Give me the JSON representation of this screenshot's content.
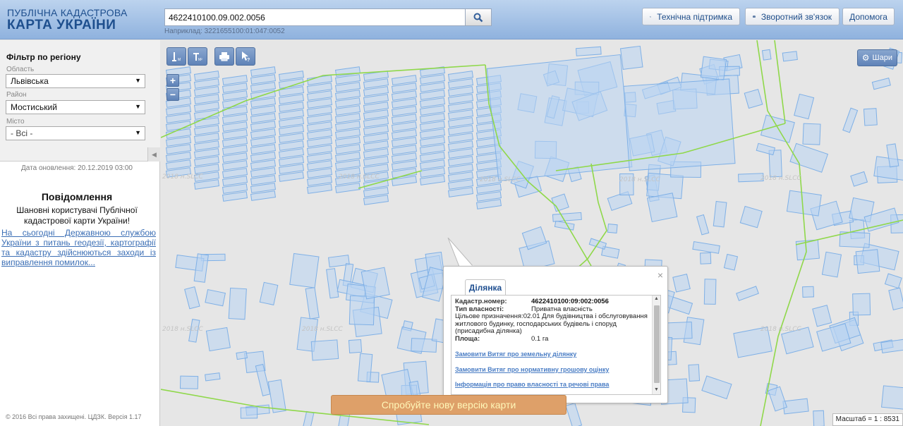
{
  "header": {
    "logo_line1": "ПУБЛІЧНА КАДАСТРОВА",
    "logo_line2": "КАРТА УКРАЇНИ",
    "search_value": "4622410100.09.002.0056",
    "search_example": "Наприклад: 3221655100:01:047:0052",
    "support_label": "Технічна підтримка",
    "feedback_label": "Зворотний зв'язок",
    "help_label": "Допомога"
  },
  "sidebar": {
    "filter_title": "Фільтр по регіону",
    "oblast_label": "Область",
    "oblast_value": "Львівська",
    "raion_label": "Район",
    "raion_value": "Мостиський",
    "misto_label": "Місто",
    "misto_value": "- Всі -",
    "update_date": "Дата оновлення: 20.12.2019 03:00",
    "notice_title": "Повідомлення",
    "notice_greeting": "Шановні користувачі Публічної кадастрової карти України!",
    "notice_link": "На сьогодні Державною службою України з питань геодезії, картографії та кадастру здійснюються заходи із виправлення помилок...",
    "copyright": "© 2016 Всі права захищені. ЦДЗК. Версія 1.17"
  },
  "map": {
    "layers_label": "Шари",
    "watermark": "2018 н.SLCC",
    "scale_label": "Масштаб = 1 : 8531",
    "try_new_label": "Спробуйте нову версію карти",
    "popup": {
      "tab_label": "Ділянка",
      "close_symbol": "×",
      "fields": [
        {
          "key": "Кадастр.номер:",
          "value": "4622410100:09:002:0056"
        },
        {
          "key": "Тип власності:",
          "value": "Приватна власність"
        },
        {
          "key": "Цільове призначення:",
          "value": "02.01 Для будівництва і обслуговування житлового будинку, господарських будівель і споруд (присадибна ділянка)"
        },
        {
          "key": "Площа:",
          "value": "0.1 га"
        }
      ],
      "links": [
        "Замовити Витяг про земельну ділянку",
        "Замовити Витяг про нормативну грошову оцінку",
        "Інформація про право власності та речові права"
      ]
    }
  },
  "colors": {
    "parcel_fill": "#b8d4f2",
    "parcel_stroke": "#7fb0e6",
    "boundary_green": "#8fd84a",
    "button_blue": "#6f90c2",
    "try_new_bg": "#dea069"
  }
}
